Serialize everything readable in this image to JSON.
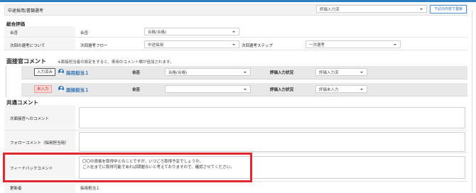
{
  "header": {
    "title": "中途採用/書類選考",
    "status_select": "評価入力済",
    "register_button": "下記の内容で登録"
  },
  "overall": {
    "section_title": "総合評価",
    "result_label": "合否",
    "result_value": "合否",
    "result_select": "合格(合格)",
    "next_label": "次回の選考について",
    "next_flow_label": "次回選考フロー",
    "next_flow_select": "中途採用",
    "next_step_label": "次回選考ステップ",
    "next_step_select": "一次選考"
  },
  "interviewer": {
    "section_title": "面接官コメント",
    "note": "※面接担当者の設定をすると、専用のコメント欄が追加されます。",
    "rows": [
      {
        "badge": "入力済み",
        "name": "採用担当１",
        "result_label": "合否",
        "result_select": "合格(合格)",
        "status_label": "評価入力状況",
        "status_select": "評価入力済"
      },
      {
        "badge": "未入力",
        "name": "面接担当１",
        "result_label": "合否",
        "result_select": "",
        "status_label": "評価入力状況",
        "status_select": "評価未入力"
      }
    ]
  },
  "common": {
    "section_title": "共通コメント",
    "next_interviewer_label": "次面接官へのコメント",
    "followup_label": "フォローコメント（採用担当用）",
    "feedback_label": "フィードバックコメント",
    "feedback_lines": [
      "〇〇の資格を取得中とのことですが、いつごろ取得予定でしょうか。",
      "ご入社までに取得可能であれば問題ないと考えておりますので、確認させてください。"
    ],
    "updater_label": "更新者",
    "updater_value": "採用担当１"
  },
  "colors": {
    "accent": "#2f7fc1",
    "highlight": "#e0282e",
    "pending_badge_bg": "#f7d6d6",
    "pending_badge_text": "#c03030",
    "person_name": "#2f6fb2"
  },
  "icons": {
    "user": "user-icon",
    "caret": "chevron-down-icon"
  }
}
